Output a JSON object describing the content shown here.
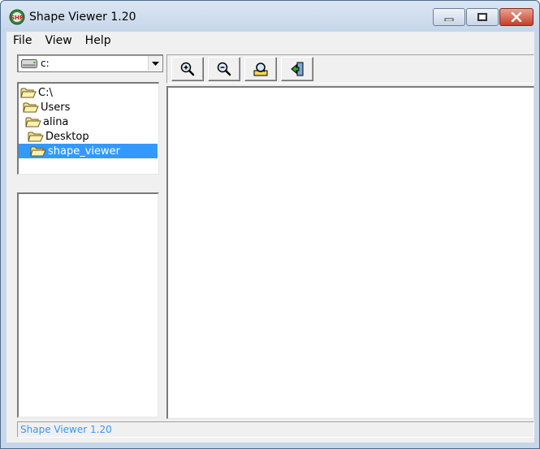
{
  "window": {
    "title": "Shape Viewer 1.20"
  },
  "menu": [
    "File",
    "View",
    "Help"
  ],
  "drive": {
    "label": "c:"
  },
  "directories": [
    {
      "label": "C:\\",
      "selected": false
    },
    {
      "label": "Users",
      "selected": false
    },
    {
      "label": "alina",
      "selected": false
    },
    {
      "label": "Desktop",
      "selected": false
    },
    {
      "label": "shape_viewer",
      "selected": true
    }
  ],
  "toolbar": {
    "buttons": [
      "zoom-in-icon",
      "zoom-out-icon",
      "find-icon",
      "exit-icon"
    ]
  },
  "status": {
    "text": "Shape Viewer 1.20"
  },
  "colors": {
    "selection": "#3399ff",
    "status_text": "#3399ff",
    "close_button": "#c4402a"
  }
}
